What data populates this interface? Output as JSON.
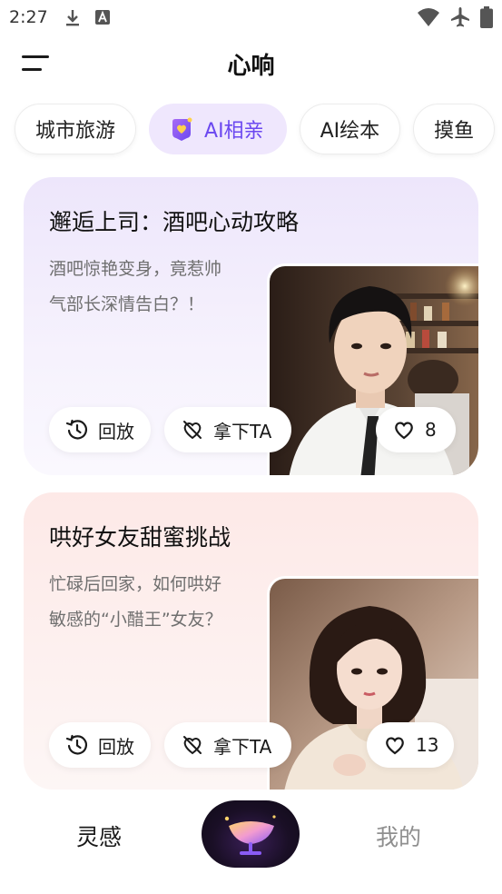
{
  "status_bar": {
    "time": "2:27"
  },
  "header": {
    "title": "心响"
  },
  "categories": [
    {
      "label": "城市旅游",
      "active": false
    },
    {
      "label": "AI相亲",
      "active": true
    },
    {
      "label": "AI绘本",
      "active": false
    },
    {
      "label": "摸鱼",
      "active": false
    }
  ],
  "cards": [
    {
      "title": "邂逅上司：酒吧心动攻略",
      "description": "酒吧惊艳变身，竟惹帅气部长深情告白？！",
      "replay_label": "回放",
      "take_label": "拿下TA",
      "likes": "8",
      "accent": "#ede6fb"
    },
    {
      "title": "哄好女友甜蜜挑战",
      "description": "忙碌后回家，如何哄好敏感的“小醋王”女友？",
      "replay_label": "回放",
      "take_label": "拿下TA",
      "likes": "13",
      "accent": "#fde9e7"
    }
  ],
  "bottom_nav": {
    "left_label": "灵感",
    "right_label": "我的"
  },
  "colors": {
    "accent_purple": "#6b48f0",
    "chip_active_bg": "#efe7fd"
  }
}
